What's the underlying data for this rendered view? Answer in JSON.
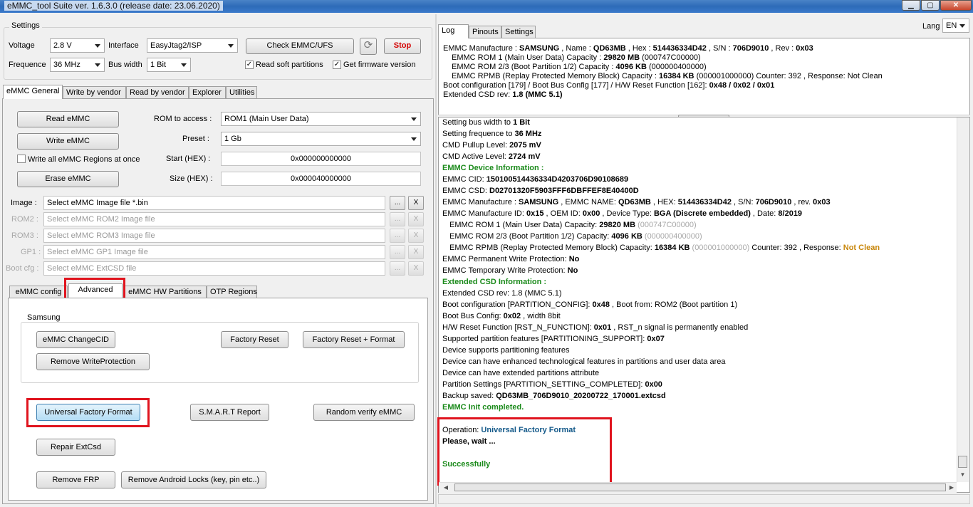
{
  "window": {
    "title": "eMMC_tool Suite  ver. 1.6.3.0 (release date: 23.06.2020)"
  },
  "settings": {
    "group_label": "Settings",
    "voltage_label": "Voltage",
    "voltage_value": "2.8 V",
    "interface_label": "Interface",
    "interface_value": "EasyJtag2/ISP",
    "frequency_label": "Frequence",
    "frequency_value": "36 MHz",
    "bus_width_label": "Bus width",
    "bus_width_value": "1 Bit",
    "check_button": "Check EMMC/UFS",
    "stop_button": "Stop",
    "read_soft_partitions": "Read soft partitions",
    "get_firmware_version": "Get firmware version"
  },
  "main_tabs": [
    "eMMC General",
    "Write by vendor",
    "Read by vendor",
    "Explorer",
    "Utilities"
  ],
  "general": {
    "read_button": "Read eMMC",
    "write_button": "Write eMMC",
    "write_all_label": "Write all eMMC Regions at once",
    "erase_button": "Erase eMMC",
    "rom_label": "ROM to access :",
    "rom_value": "ROM1 (Main User Data)",
    "preset_label": "Preset :",
    "preset_value": "1 Gb",
    "start_label": "Start (HEX) :",
    "start_value": "0x000000000000",
    "size_label": "Size (HEX) :",
    "size_value": "0x000040000000"
  },
  "images": [
    {
      "label": "Image :",
      "placeholder": "Select eMMC Image file *.bin"
    },
    {
      "label": "ROM2 :",
      "placeholder": "Select eMMC ROM2 Image file"
    },
    {
      "label": "ROM3 :",
      "placeholder": "Select eMMC ROM3 Image file"
    },
    {
      "label": "GP1 :",
      "placeholder": "Select eMMC GP1 Image file"
    },
    {
      "label": "Boot cfg :",
      "placeholder": "Select eMMC ExtCSD file"
    }
  ],
  "browse_label": "...",
  "clear_label": "X",
  "sub_tabs": [
    "eMMC config",
    "Advanced",
    "eMMC HW Partitions",
    "OTP Regions"
  ],
  "advanced": {
    "samsung_label": "Samsung",
    "change_cid": "eMMC ChangeCID",
    "factory_reset": "Factory Reset",
    "factory_reset_format": "Factory Reset + Format",
    "remove_wp": "Remove WriteProtection",
    "universal_factory_format": "Universal Factory Format",
    "smart_report": "S.M.A.R.T Report",
    "random_verify": "Random verify eMMC",
    "repair_extcsd": "Repair ExtCsd",
    "remove_frp": "Remove FRP",
    "remove_android_locks": "Remove Android Locks (key, pin etc..)"
  },
  "right_tabs": [
    "Log",
    "Pinouts",
    "Settings"
  ],
  "lang": {
    "label": "Lang",
    "value": "EN"
  },
  "summary": {
    "l1_pre": "EMMC Manufacture : ",
    "l1_manuf": "SAMSUNG",
    "l1_name_label": " , Name : ",
    "l1_name": "QD63MB",
    "l1_hex_label": " , Hex : ",
    "l1_hex": "514436334D42",
    "l1_sn_label": " , S/N : ",
    "l1_sn": "706D9010",
    "l1_rev_label": " , Rev : ",
    "l1_rev": "0x03",
    "l2_pre": "EMMC ROM 1 (Main User Data) Capacity : ",
    "l2_val": "29820 MB",
    "l2_post": " (000747C00000)",
    "l3_pre": "EMMC ROM 2/3 (Boot Partition 1/2) Capacity : ",
    "l3_val": "4096 KB",
    "l3_post": " (000000400000)",
    "l4_pre": "EMMC RPMB (Replay Protected Memory Block) Capacity : ",
    "l4_val": "16384 KB",
    "l4_post": " (000001000000) Counter: 392 , Response: Not Clean",
    "l5_pre": "Boot configuration [179] / Boot Bus Config [177] / H/W Reset Function [162]: ",
    "l5_val": "0x48 / 0x02 / 0x01",
    "l6_pre": "Extended CSD rev: ",
    "l6_val": "1.8 (MMC 5.1)"
  },
  "log": {
    "bus_pre": "Setting bus width to ",
    "bus_val": "1 Bit",
    "freq_pre": "Setting frequence to ",
    "freq_val": "36 MHz",
    "pullup_pre": "CMD Pullup Level: ",
    "pullup_val": "2075  mV",
    "active_pre": "CMD Active Level: ",
    "active_val": "2724  mV",
    "dev_info": "EMMC Device Information :",
    "cid_pre": "EMMC CID: ",
    "cid_val": "150100514436334D4203706D90108689",
    "csd_pre": "EMMC CSD: ",
    "csd_val": "D02701320F5903FFF6DBFFEF8E40400D",
    "manuf_pre": "EMMC Manufacture : ",
    "manuf_val": "SAMSUNG",
    "manuf_name_lbl": " , EMMC NAME: ",
    "manuf_name": "QD63MB",
    "manuf_hex_lbl": " , HEX: ",
    "manuf_hex": "514436334D42",
    "manuf_sn_lbl": " , S/N: ",
    "manuf_sn": "706D9010",
    "manuf_rev_lbl": " , rev. ",
    "manuf_rev": "0x03",
    "mid_pre": "EMMC Manufacture ID: ",
    "mid_val": "0x15",
    "oem_lbl": " , OEM ID: ",
    "oem_val": "0x00",
    "dtype_lbl": " , Device Type: ",
    "dtype_val": "BGA (Discrete embedded)",
    "date_lbl": " , Date: ",
    "date_val": "8/2019",
    "rom1_pre": "EMMC ROM 1 (Main User Data) Capacity: ",
    "rom1_val": "29820 MB",
    "rom1_hex": "(000747C00000)",
    "rom23_pre": "EMMC ROM 2/3 (Boot Partition 1/2) Capacity: ",
    "rom23_val": "4096 KB",
    "rom23_hex": "(000000400000)",
    "rpmb_pre": "EMMC RPMB (Replay Protected Memory Block) Capacity: ",
    "rpmb_val": "16384 KB",
    "rpmb_hex": "(000001000000)",
    "rpmb_post": " Counter: 392 , Response: ",
    "rpmb_resp": "Not Clean",
    "pwp_pre": "EMMC Permanent Write Protection: ",
    "pwp_val": "No",
    "twp_pre": "EMMC Temporary Write Protection: ",
    "twp_val": "No",
    "ext_info": "Extended CSD Information :",
    "extrev": "Extended CSD rev: 1.8 (MMC 5.1)",
    "bootcfg_pre": "Boot configuration [PARTITION_CONFIG]: ",
    "bootcfg_val": "0x48",
    "bootcfg_post": " , Boot from: ROM2 (Boot partition 1)",
    "bootbus_pre": "Boot Bus Config: ",
    "bootbus_val": "0x02",
    "bootbus_post": " , width 8bit",
    "hwreset_pre": "H/W Reset Function [RST_N_FUNCTION]: ",
    "hwreset_val": "0x01",
    "hwreset_post": " , RST_n signal is permanently enabled",
    "supp_pre": "Supported partition features [PARTITIONING_SUPPORT]: ",
    "supp_val": "0x07",
    "f1": "Device supports partitioning features",
    "f2": "Device can have enhanced technological features in partitions and user data area",
    "f3": "Device can have extended partitions attribute",
    "pset_pre": "Partition Settings [PARTITION_SETTING_COMPLETED]: ",
    "pset_val": "0x00",
    "backup_pre": "Backup saved: ",
    "backup_val": "QD63MB_706D9010_20200722_170001.extcsd",
    "init_done": "EMMC Init completed.",
    "op_pre": "Operation: ",
    "op_val": "Universal Factory Format",
    "wait": "Please, wait ...",
    "success": "Successfully"
  },
  "colors": {
    "highlight": "#e0141e",
    "green": "#1a8a1a",
    "blue": "#155a8a",
    "orange": "#c8860a"
  }
}
